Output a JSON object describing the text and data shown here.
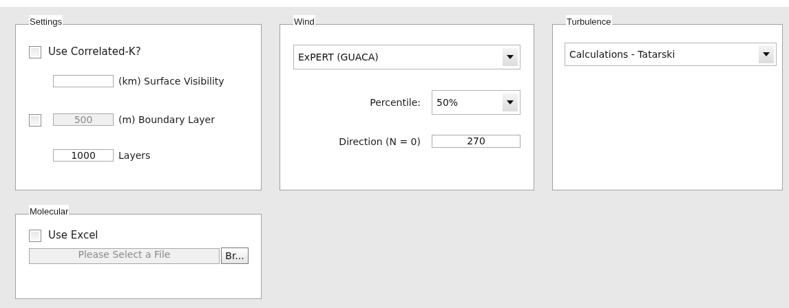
{
  "settings": {
    "title": "Settings",
    "use_correlated_k": {
      "label": "Use Correlated-K?",
      "checked": false
    },
    "rows": [
      {
        "kind": "field",
        "label": "(km) Surface Visibility",
        "disabled": false
      },
      {
        "kind": "check-field",
        "checked": false,
        "value": "500",
        "label": "(m) Boundary Layer",
        "disabled": true
      },
      {
        "kind": "field",
        "value": "1000",
        "label": "Layers",
        "disabled": false
      }
    ]
  },
  "wind": {
    "title": "Wind",
    "model": {
      "value": "ExPERT (GUACA)"
    },
    "percentile": {
      "label": "Percentile:",
      "value": "50%"
    },
    "direction": {
      "label": "Direction (N = 0)",
      "value": "270"
    }
  },
  "turbulence": {
    "title": "Turbulence",
    "model": {
      "value": "Calculations - Tatarski"
    }
  },
  "molecular": {
    "title": "Molecular",
    "use_excel": {
      "label": "Use Excel",
      "checked": false
    },
    "file": {
      "value": "Please Select a File",
      "disabled": true
    },
    "browse_button": {
      "label": "Br..."
    }
  }
}
